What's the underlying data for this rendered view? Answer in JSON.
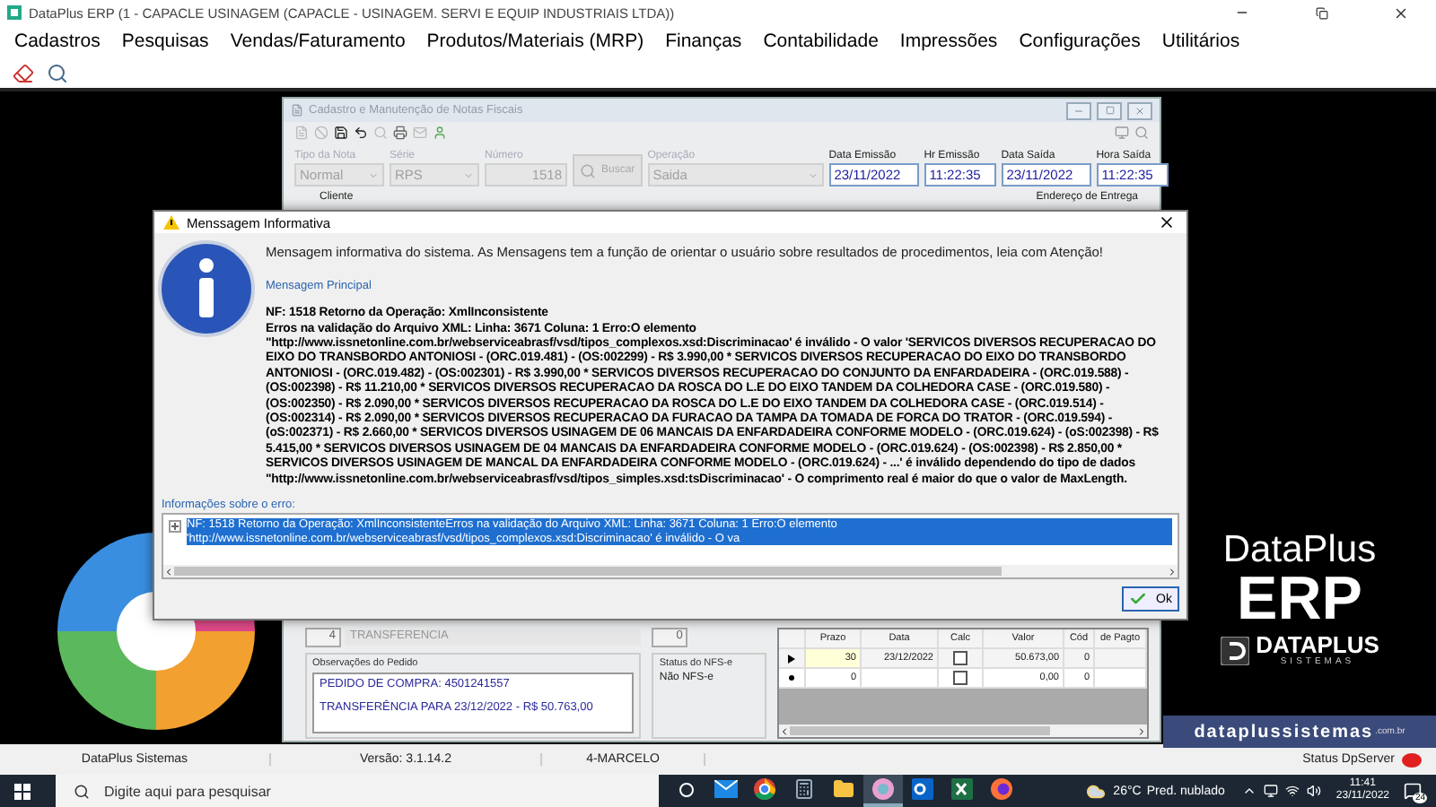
{
  "app": {
    "title": "DataPlus ERP (1 - CAPACLE USINAGEM  (CAPACLE - USINAGEM. SERVI E EQUIP INDUSTRIAIS LTDA))"
  },
  "menu": [
    "Cadastros",
    "Pesquisas",
    "Vendas/Faturamento",
    "Produtos/Materiais (MRP)",
    "Finanças",
    "Contabilidade",
    "Impressões",
    "Configurações",
    "Utilitários"
  ],
  "form_window": {
    "title": "Cadastro e Manutenção de Notas Fiscais",
    "fields": [
      {
        "label": "Tipo da Nota",
        "value": "Normal",
        "kind": "select",
        "disabled": true
      },
      {
        "label": "Série",
        "value": "RPS",
        "kind": "select",
        "disabled": true
      },
      {
        "label": "Número",
        "value": "1518",
        "kind": "number",
        "disabled": true
      },
      {
        "label": "Operação",
        "value": "Saida",
        "kind": "wide-select",
        "disabled": true
      },
      {
        "label": "Data Emissão",
        "value": "23/11/2022",
        "kind": "date",
        "disabled": false
      },
      {
        "label": "Hr Emissão",
        "value": "11:22:35",
        "kind": "date",
        "disabled": false
      },
      {
        "label": "Data Saída",
        "value": "23/11/2022",
        "kind": "date",
        "disabled": false
      },
      {
        "label": "Hora Saída",
        "value": "11:22:35",
        "kind": "date",
        "disabled": false
      }
    ],
    "search_button": {
      "label": "Buscar",
      "disabled": true
    },
    "client_label": "Cliente",
    "delivery_label": "Endereço de Entrega",
    "operation_type": {
      "code": "4",
      "name": "TRANSFERENCIA"
    },
    "field_2": "0",
    "observations": {
      "label": "Observações do Pedido",
      "lines": [
        "PEDIDO DE COMPRA: 4501241557",
        "TRANSFERÊNCIA PARA 23/12/2022 - R$ 50.763,00"
      ]
    },
    "nfse_status": {
      "label": "Status do NFS-e",
      "value": "Não NFS-e"
    },
    "payments": {
      "columns": [
        "Prazo",
        "Data",
        "Calc",
        "Valor",
        "Cód",
        "de Pagto"
      ],
      "rows": [
        {
          "kind": "current",
          "prazo": "30",
          "data": "23/12/2022",
          "calc": false,
          "valor": "50.673,00",
          "cod": "0"
        },
        {
          "kind": "new",
          "prazo": "0",
          "calc": false,
          "valor": "0,00",
          "cod": "0"
        }
      ]
    }
  },
  "dialog": {
    "title": "Menssagem Informativa",
    "intro": "Mensagem informativa do sistema. As Mensagens tem a função de orientar o usuário sobre resultados de procedimentos, leia com Atenção!",
    "section_label": "Mensagem Principal",
    "message_lines": [
      "NF: 1518 Retorno da Operação: XmlInconsistente",
      "Erros na validação do Arquivo XML: Linha: 3671 Coluna: 1 Erro:O elemento",
      "\"http://www.issnetonline.com.br/webserviceabrasf/vsd/tipos_complexos.xsd:Discriminacao' é inválido - O valor 'SERVICOS DIVERSOS RECUPERACAO DO EIXO DO TRANSBORDO ANTONIOSI - (ORC.019.481) - (OS:002299) - R$ 3.990,00 * SERVICOS DIVERSOS RECUPERACAO DO EIXO DO TRANSBORDO ANTONIOSI - (ORC.019.482) - (OS:002301) - R$ 3.990,00 * SERVICOS DIVERSOS RECUPERACAO DO CONJUNTO DA ENFARDADEIRA - (ORC.019.588) - (OS:002398) - R$ 11.210,00 * SERVICOS DIVERSOS RECUPERACAO DA ROSCA DO L.E DO EIXO TANDEM DA COLHEDORA CASE - (ORC.019.580) - (OS:002350) - R$ 2.090,00 * SERVICOS DIVERSOS RECUPERACAO DA ROSCA DO L.E DO EIXO TANDEM DA COLHEDORA CASE - (ORC.019.514) - (OS:002314) - R$ 2.090,00 * SERVICOS DIVERSOS RECUPERACAO DA FURACAO DA TAMPA DA TOMADA DE FORCA DO TRATOR - (ORC.019.594) - (oS:002371) - R$ 2.660,00 * SERVICOS DIVERSOS USINAGEM DE 06 MANCAIS DA ENFARDADEIRA CONFORME MODELO - (ORC.019.624) - (oS:002398) - R$ 5.415,00 * SERVICOS DIVERSOS USINAGEM DE 04 MANCAIS DA ENFARDADEIRA CONFORME MODELO - (ORC.019.624) - (OS:002398) - R$ 2.850,00 * SERVICOS DIVERSOS USINAGEM DE MANCAL DA ENFARDADEIRA CONFORME MODELO - (ORC.019.624) - ...' é inválido dependendo do tipo de dados",
      "\"http://www.issnetonline.com.br/webserviceabrasf/vsd/tipos_simples.xsd:tsDiscriminacao' - O comprimento real é maior do que o valor de MaxLength."
    ],
    "details_label": "Informações sobre o erro:",
    "details": [
      {
        "text": "NF: 1518 Retorno da Operação: XmlInconsistenteErros na validação do Arquivo XML: Linha: 3671 Coluna: 1 Erro:O elemento 'http://www.issnetonline.com.br/webserviceabrasf/vsd/tipos_complexos.xsd:Discriminacao' é inválido - O va",
        "selected": true,
        "expanded": false
      }
    ],
    "ok_button": "Ok"
  },
  "branding": {
    "name": "DataPlus",
    "product": "ERP",
    "company": "DATAPLUS",
    "tagline": "SISTEMAS",
    "website": "dataplussistemas",
    "website_suffix": ".com.br"
  },
  "status_bar": [
    "DataPlus Sistemas",
    "Versão: 3.1.14.2",
    "4-MARCELO"
  ],
  "server_status": {
    "label": "Status DpServer",
    "online": false
  },
  "taskbar": {
    "search_placeholder": "Digite aqui para pesquisar",
    "apps": [
      {
        "kind": "mail",
        "selected": false
      },
      {
        "kind": "chrome",
        "selected": false
      },
      {
        "kind": "calculator",
        "selected": false
      },
      {
        "kind": "folder",
        "selected": false
      },
      {
        "kind": "dataplus",
        "selected": true
      },
      {
        "kind": "outlook",
        "selected": false
      },
      {
        "kind": "excel",
        "selected": false
      },
      {
        "kind": "firefox",
        "selected": false
      }
    ],
    "weather": {
      "temp": "26°C",
      "condition": "Pred. nublado"
    },
    "time": "11:41",
    "date": "23/11/2022",
    "notifications": "24"
  }
}
